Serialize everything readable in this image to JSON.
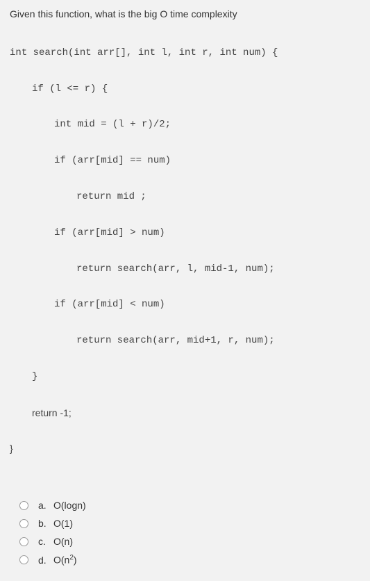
{
  "question": "Given this function, what is the big O time complexity",
  "code": {
    "l1": "int search(int arr[], int l, int r, int num) {",
    "l2": "if (l <= r) {",
    "l3": "int mid = (l + r)/2;",
    "l4": "if (arr[mid] == num)",
    "l5": "return mid ;",
    "l6": "if (arr[mid] > num)",
    "l7": "return search(arr, l, mid-1, num);",
    "l8": "if (arr[mid] < num)",
    "l9": "return search(arr, mid+1, r, num);",
    "l10": "}",
    "l11": "return -1;",
    "l12": "}"
  },
  "options": {
    "a": {
      "letter": "a.",
      "text": "O(logn)"
    },
    "b": {
      "letter": "b.",
      "text": "O(1)"
    },
    "c": {
      "letter": "c.",
      "text": "O(n)"
    },
    "d": {
      "letter": "d.",
      "html": "O(n<sup>2</sup>)"
    }
  }
}
